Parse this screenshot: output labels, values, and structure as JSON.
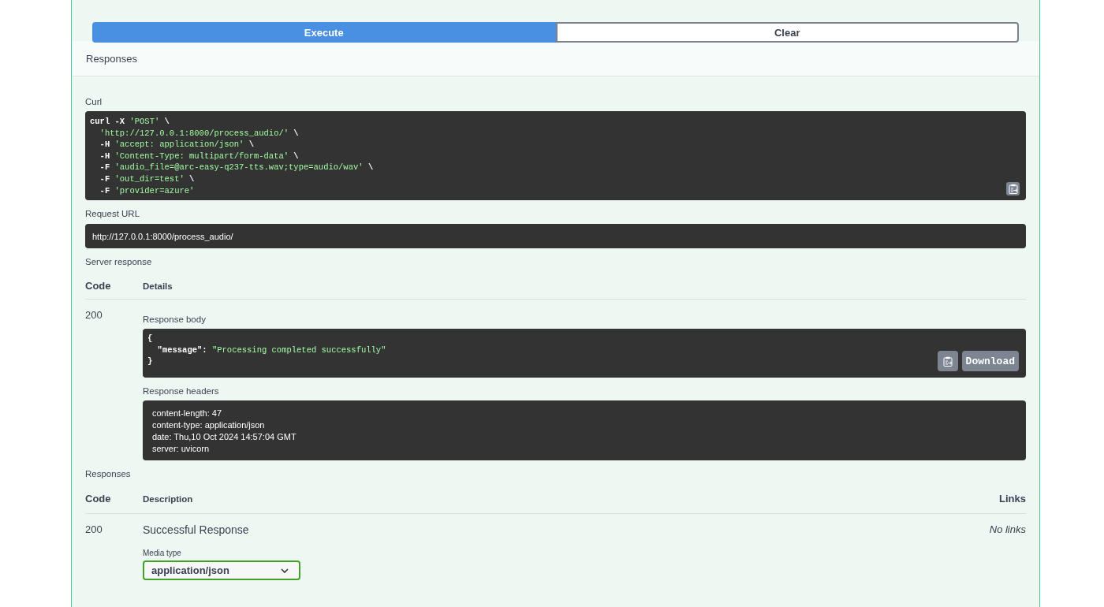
{
  "actions": {
    "execute": "Execute",
    "clear": "Clear"
  },
  "responses_title": "Responses",
  "curl": {
    "label": "Curl",
    "lines": [
      [
        {
          "t": "curl -X ",
          "kind": "plain"
        },
        {
          "t": "'POST'",
          "kind": "string"
        },
        {
          "t": " \\",
          "kind": "plain"
        }
      ],
      [
        {
          "t": "  'http://127.0.0.1:8000/process_audio/'",
          "kind": "string"
        },
        {
          "t": " \\",
          "kind": "plain"
        }
      ],
      [
        {
          "t": "  -H ",
          "kind": "plain"
        },
        {
          "t": "'accept: application/json'",
          "kind": "string"
        },
        {
          "t": " \\",
          "kind": "plain"
        }
      ],
      [
        {
          "t": "  -H ",
          "kind": "plain"
        },
        {
          "t": "'Content-Type: multipart/form-data'",
          "kind": "string"
        },
        {
          "t": " \\",
          "kind": "plain"
        }
      ],
      [
        {
          "t": "  -F ",
          "kind": "plain"
        },
        {
          "t": "'audio_file=@arc-easy-q237-tts.wav;type=audio/wav'",
          "kind": "string"
        },
        {
          "t": " \\",
          "kind": "plain"
        }
      ],
      [
        {
          "t": "  -F ",
          "kind": "plain"
        },
        {
          "t": "'out_dir=test'",
          "kind": "string"
        },
        {
          "t": " \\",
          "kind": "plain"
        }
      ],
      [
        {
          "t": "  -F ",
          "kind": "plain"
        },
        {
          "t": "'provider=azure'",
          "kind": "string"
        }
      ]
    ]
  },
  "request_url": {
    "label": "Request URL",
    "value": "http://127.0.0.1:8000/process_audio/"
  },
  "server_response": {
    "label": "Server response",
    "columns": [
      "Code",
      "Details"
    ],
    "code": "200",
    "body_label": "Response body",
    "body_lines": [
      [
        {
          "t": "{",
          "kind": "plain"
        }
      ],
      [
        {
          "t": "  \"message\"",
          "kind": "plain"
        },
        {
          "t": ": ",
          "kind": "plain"
        },
        {
          "t": "\"Processing completed successfully\"",
          "kind": "string"
        }
      ],
      [
        {
          "t": "}",
          "kind": "plain"
        }
      ]
    ],
    "download": "Download",
    "headers_label": "Response headers",
    "headers": [
      "content-length: 47",
      "content-type: application/json",
      "date: Thu,10 Oct 2024 14:57:04 GMT",
      "server: uvicorn"
    ]
  },
  "responses": {
    "label": "Responses",
    "columns": [
      "Code",
      "Description",
      "Links"
    ],
    "rows": [
      {
        "code": "200",
        "description": "Successful Response",
        "links": "No links",
        "media_type_label": "Media type",
        "media_type": "application/json"
      }
    ]
  }
}
